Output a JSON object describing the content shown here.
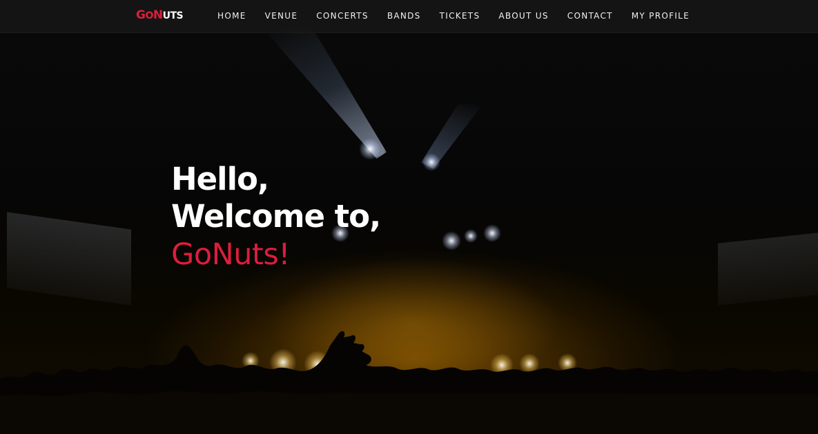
{
  "nav": {
    "logo": {
      "letters": [
        {
          "text": "G",
          "size": "big",
          "tone": "red"
        },
        {
          "text": "O",
          "size": "small",
          "tone": "red"
        },
        {
          "text": "N",
          "size": "big",
          "tone": "red"
        },
        {
          "text": "UTS",
          "size": "small",
          "tone": "white"
        }
      ]
    },
    "links": [
      {
        "label": "HOME",
        "name": "nav-home"
      },
      {
        "label": "VENUE",
        "name": "nav-venue"
      },
      {
        "label": "CONCERTS",
        "name": "nav-concerts"
      },
      {
        "label": "BANDS",
        "name": "nav-bands"
      },
      {
        "label": "TICKETS",
        "name": "nav-tickets"
      },
      {
        "label": "ABOUT US",
        "name": "nav-about-us"
      },
      {
        "label": "CONTACT",
        "name": "nav-contact"
      },
      {
        "label": "MY PROFILE",
        "name": "nav-my-profile"
      }
    ]
  },
  "hero": {
    "line1": "Hello,",
    "line2": "Welcome to,",
    "brand": "GoNuts!"
  },
  "colors": {
    "accent": "#dc1e3c",
    "text": "#ffffff",
    "navbar": "#161616"
  },
  "background": {
    "image": "concert-crowd-stage-lights"
  }
}
